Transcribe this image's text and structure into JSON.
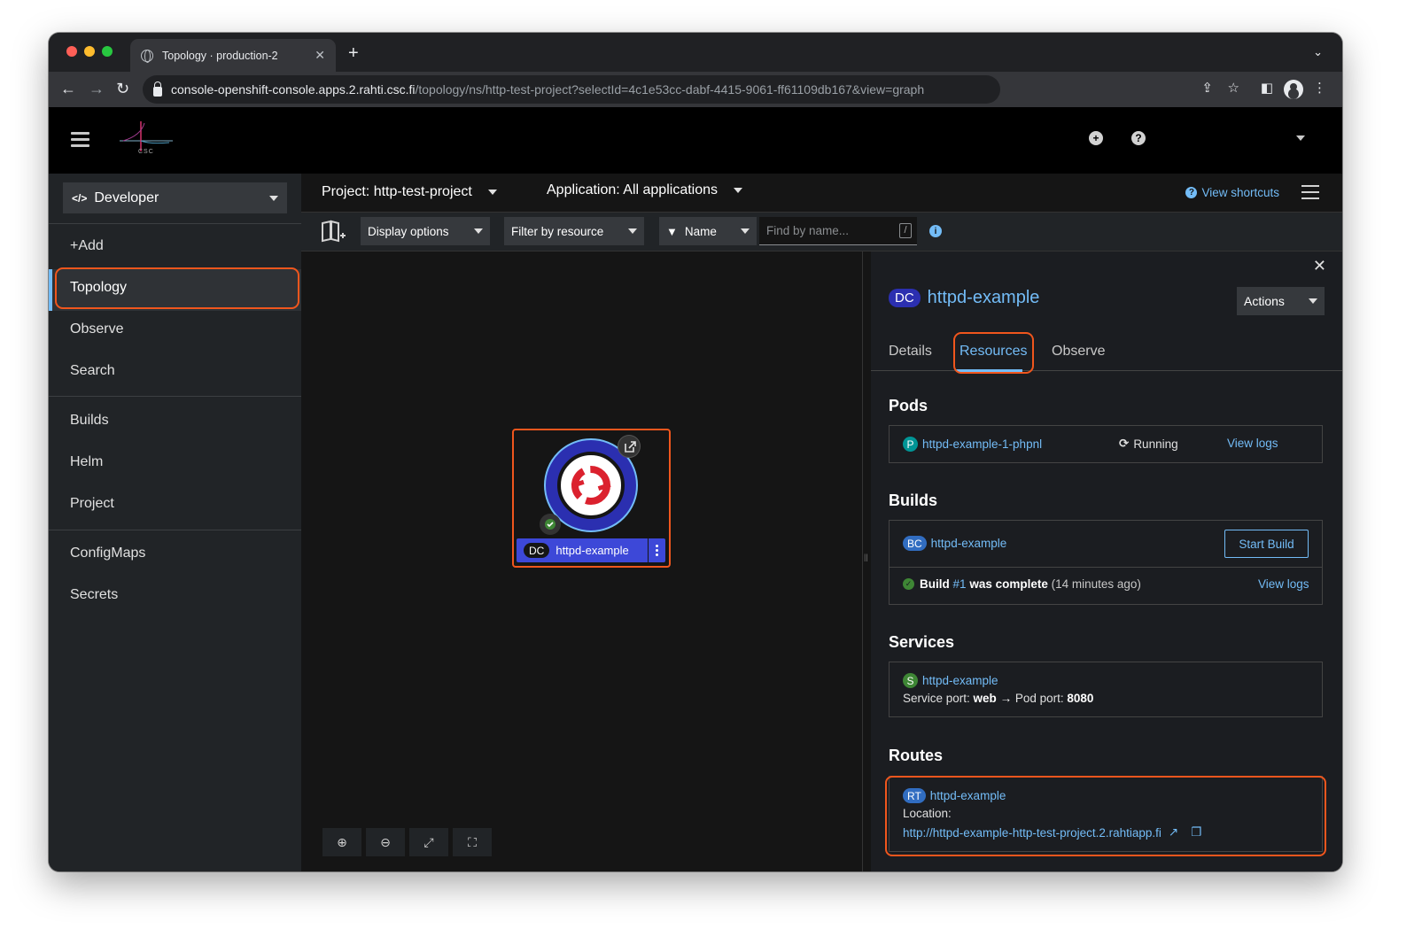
{
  "browser": {
    "tab_title": "Topology · production-2",
    "url_host": "console-openshift-console.apps.2.rahti.csc.fi",
    "url_path": "/topology/ns/http-test-project?selectId=4c1e53cc-dabf-4415-9061-ff61109db167&view=graph"
  },
  "masthead": {
    "logo_text": "CSC"
  },
  "sidebar": {
    "perspective": "Developer",
    "items": [
      "+Add",
      "Topology",
      "Observe",
      "Search",
      "Builds",
      "Helm",
      "Project",
      "ConfigMaps",
      "Secrets"
    ]
  },
  "project_bar": {
    "project": "Project: http-test-project",
    "application": "Application: All applications",
    "shortcuts": "View shortcuts"
  },
  "toolbar": {
    "display_options": "Display options",
    "filter_by_resource": "Filter by resource",
    "name_filter": "Name",
    "find_placeholder": "Find by name...",
    "slash_hint": "/"
  },
  "node": {
    "kind": "DC",
    "name": "httpd-example"
  },
  "panel": {
    "kind": "DC",
    "title": "httpd-example",
    "actions": "Actions",
    "tabs": [
      "Details",
      "Resources",
      "Observe"
    ],
    "pods": {
      "heading": "Pods",
      "badge": "P",
      "name": "httpd-example-1-phpnl",
      "status": "Running",
      "view_logs": "View logs"
    },
    "builds": {
      "heading": "Builds",
      "badge": "BC",
      "name": "httpd-example",
      "start_build": "Start Build",
      "build_prefix": "Build",
      "build_number": "#1",
      "build_suffix": "was complete",
      "build_time": "(14 minutes ago)",
      "view_logs": "View logs"
    },
    "services": {
      "heading": "Services",
      "badge": "S",
      "name": "httpd-example",
      "service_port_label": "Service port:",
      "service_port": "web",
      "arrow": "→",
      "pod_port_label": "Pod port:",
      "pod_port": "8080"
    },
    "routes": {
      "heading": "Routes",
      "badge": "RT",
      "name": "httpd-example",
      "location_label": "Location:",
      "location_url": "http://httpd-example-http-test-project.2.rahtiapp.fi"
    }
  },
  "colors": {
    "accent_link": "#73bcf7",
    "highlight": "#f0561d",
    "node_fill": "#2b2fb0"
  }
}
